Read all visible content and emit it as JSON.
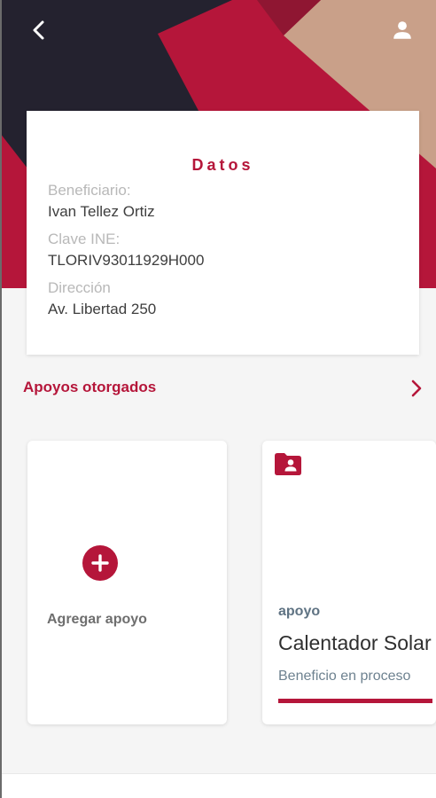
{
  "colors": {
    "accent": "#b5163a",
    "hero_dark": "#24222f",
    "hero_red": "#b5163a",
    "hero_tan": "#c9a089"
  },
  "icons": {
    "back": "arrow-back-icon",
    "user": "account-icon",
    "chevron": "chevron-right-icon",
    "plus": "plus-icon",
    "folder": "folder-account-icon"
  },
  "datos": {
    "title": "Datos",
    "beneficiario_label": "Beneficiario:",
    "beneficiario_value": "Ivan Tellez Ortiz",
    "clave_label": "Clave INE:",
    "clave_value": "TLORIV93011929H000",
    "direccion_label": "Dirección",
    "direccion_value": "Av. Libertad 250"
  },
  "apoyos": {
    "header": "Apoyos otorgados",
    "add_label": "Agregar apoyo",
    "items": [
      {
        "type": "apoyo",
        "title": "Calentador Solar",
        "status": "Beneficio en proceso",
        "progress": 1.0
      }
    ]
  }
}
